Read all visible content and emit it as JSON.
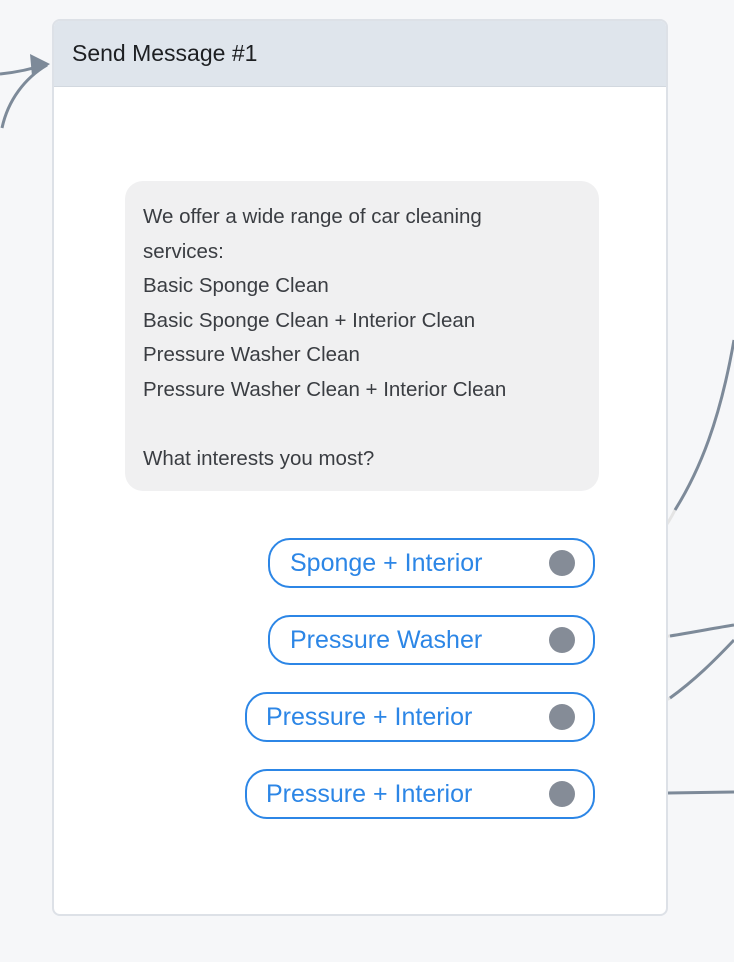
{
  "node": {
    "title": "Send Message #1",
    "message_lines": [
      "We offer a wide range of car cleaning",
      "services:",
      "Basic Sponge Clean",
      "Basic Sponge Clean + Interior Clean",
      "Pressure Washer Clean",
      "Pressure Washer Clean + Interior Clean",
      "",
      "What interests you most?"
    ],
    "choices": [
      {
        "label": "Sponge + Interior"
      },
      {
        "label": "Pressure Washer"
      },
      {
        "label": "Pressure + Interior"
      },
      {
        "label": "Pressure + Interior"
      }
    ]
  },
  "colors": {
    "choice_accent": "#2c86e6",
    "connector": "#7d8a99",
    "header_bg": "#dfe5ec"
  }
}
